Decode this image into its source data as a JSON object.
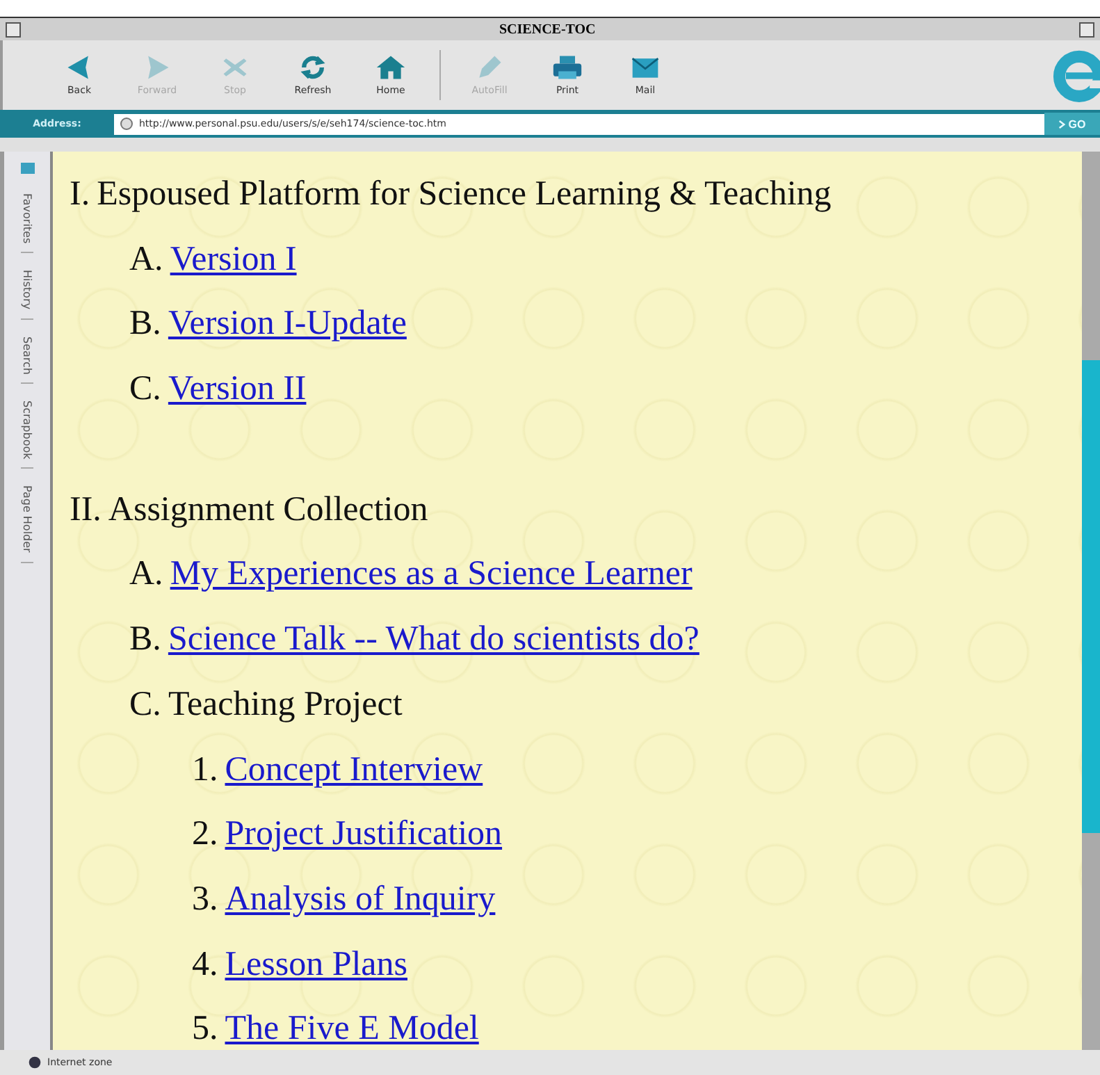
{
  "window": {
    "title": "SCIENCE-TOC"
  },
  "toolbar": [
    {
      "kind": "back",
      "label": "Back",
      "disabled": false
    },
    {
      "kind": "forward",
      "label": "Forward",
      "disabled": true
    },
    {
      "kind": "stop",
      "label": "Stop",
      "disabled": true
    },
    {
      "kind": "refresh",
      "label": "Refresh",
      "disabled": false
    },
    {
      "kind": "home",
      "label": "Home",
      "disabled": false
    },
    {
      "kind": "autofill",
      "label": "AutoFill",
      "disabled": true
    },
    {
      "kind": "print",
      "label": "Print",
      "disabled": false
    },
    {
      "kind": "mail",
      "label": "Mail",
      "disabled": false
    }
  ],
  "address_bar": {
    "label": "Address:",
    "value": "http://www.personal.psu.edu/users/s/e/seh174/science-toc.htm",
    "go": "GO"
  },
  "sidebar": {
    "tabs": [
      "Favorites",
      "History",
      "Search",
      "Scrapbook",
      "Page Holder"
    ]
  },
  "outline": [
    {
      "marker": "I.",
      "text": "Espoused Platform for Science Learning & Teaching",
      "link": false,
      "children": [
        {
          "marker": "A.",
          "text": "Version I",
          "link": true
        },
        {
          "marker": "B.",
          "text": "Version I-Update",
          "link": true
        },
        {
          "marker": "C.",
          "text": "Version II",
          "link": true
        }
      ]
    },
    {
      "marker": "II.",
      "text": "Assignment Collection",
      "link": false,
      "children": [
        {
          "marker": "A.",
          "text": "My Experiences as a Science Learner",
          "link": true
        },
        {
          "marker": "B.",
          "text": "Science Talk -- What do scientists do?",
          "link": true
        },
        {
          "marker": "C.",
          "text": "Teaching Project",
          "link": false,
          "children": [
            {
              "marker": "1.",
              "text": "Concept Interview",
              "link": true
            },
            {
              "marker": "2.",
              "text": "Project Justification",
              "link": true
            },
            {
              "marker": "3.",
              "text": "Analysis of Inquiry",
              "link": true
            },
            {
              "marker": "4.",
              "text": "Lesson Plans",
              "link": true
            },
            {
              "marker": "5.",
              "text": "The Five E Model",
              "link": true
            }
          ]
        }
      ]
    }
  ],
  "status_bar": {
    "text": "Internet zone"
  }
}
